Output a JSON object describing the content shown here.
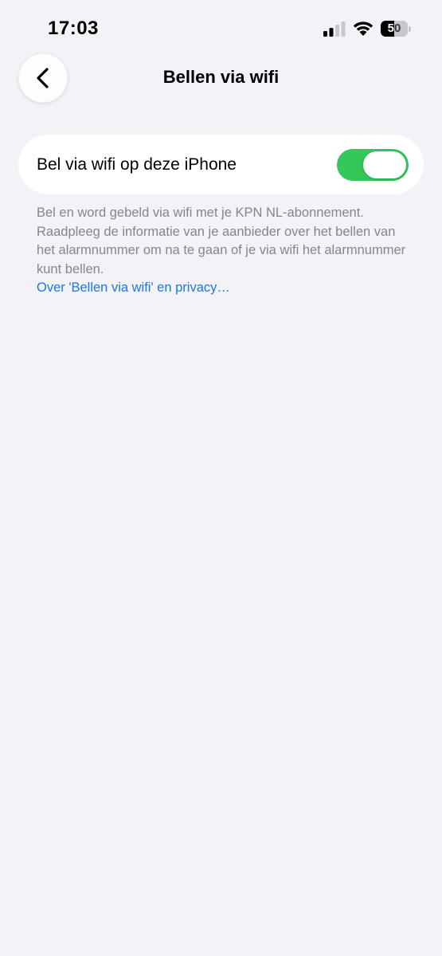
{
  "status_bar": {
    "time": "17:03",
    "battery_percent": 50,
    "battery_label": "50",
    "icons": [
      "cellular-signal-icon",
      "wifi-icon",
      "battery-icon"
    ]
  },
  "nav": {
    "back_icon": "chevron-left-icon",
    "title": "Bellen via wifi"
  },
  "setting": {
    "label": "Bel via wifi op deze iPhone",
    "toggle_on": true,
    "toggle_color": "#34c759"
  },
  "footer": {
    "description": "Bel en word gebeld via wifi met je KPN NL-abonnement. Raadpleeg de informatie van je aanbieder over het bellen van het alarmnummer om na te gaan of je via wifi het alarmnummer kunt bellen.",
    "link": "Over 'Bellen via wifi' en privacy…",
    "link_color": "#1a78e6"
  }
}
